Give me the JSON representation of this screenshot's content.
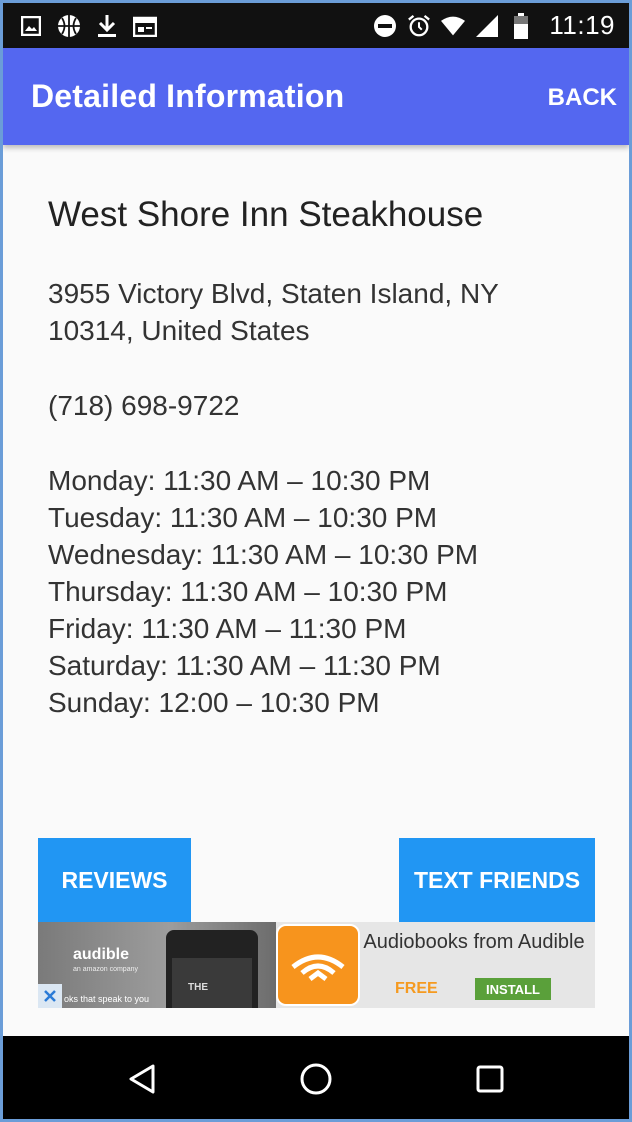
{
  "status_bar": {
    "time": "11:19",
    "left_icons": [
      "image-icon",
      "basketball-icon",
      "download-icon",
      "calendar-card-icon"
    ],
    "right_icons": [
      "do-not-disturb-icon",
      "alarm-icon",
      "wifi-icon",
      "signal-icon",
      "battery-icon"
    ]
  },
  "app_bar": {
    "title": "Detailed Information",
    "back_label": "BACK",
    "color": "#5467f0"
  },
  "place": {
    "name": "West Shore Inn Steakhouse",
    "address": "3955 Victory Blvd, Staten Island, NY 10314, United States",
    "phone": "(718) 698-9722",
    "hours": [
      "Monday: 11:30 AM – 10:30 PM",
      "Tuesday: 11:30 AM – 10:30 PM",
      "Wednesday: 11:30 AM – 10:30 PM",
      "Thursday: 11:30 AM – 10:30 PM",
      "Friday: 11:30 AM – 11:30 PM",
      "Saturday: 11:30 AM – 11:30 PM",
      "Sunday: 12:00 – 10:30 PM"
    ]
  },
  "buttons": {
    "reviews_label": "REVIEWS",
    "text_friends_label": "TEXT FRIENDS",
    "color": "#2196f3"
  },
  "ad": {
    "brand": "audible",
    "brand_sub": "an amazon company",
    "tagline": "oks that speak to you",
    "book_text": "THE",
    "title": "Audiobooks from Audible",
    "free_label": "FREE",
    "install_label": "INSTALL"
  },
  "nav_bar": {
    "icons": [
      "back-triangle-icon",
      "home-circle-icon",
      "recents-square-icon"
    ]
  }
}
